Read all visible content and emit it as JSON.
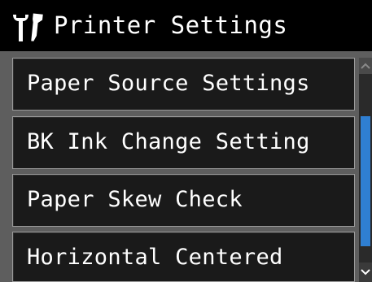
{
  "header": {
    "icon": "wrench-screwdriver-icon",
    "title": "Printer Settings"
  },
  "menu": {
    "items": [
      {
        "label": "Paper Source Settings"
      },
      {
        "label": "BK Ink Change Setting"
      },
      {
        "label": "Paper Skew Check"
      },
      {
        "label": "Horizontal Centered"
      }
    ]
  },
  "scrollbar": {
    "up_icon": "chevron-up-icon",
    "down_icon": "chevron-down-icon",
    "accent_color": "#2f7fd2"
  },
  "colors": {
    "header_bg": "#000000",
    "item_bg": "#1a1a1a",
    "panel_bg": "#5e5e5e",
    "text": "#ffffff"
  }
}
